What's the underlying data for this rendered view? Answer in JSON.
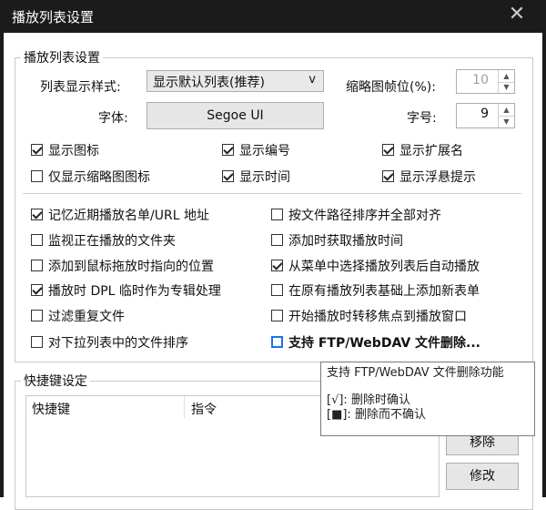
{
  "window": {
    "title": "播放列表设置",
    "close_icon": "close-icon"
  },
  "playlist_group": {
    "title": "播放列表设置",
    "display_style_label": "列表显示样式:",
    "display_style_value": "显示默认列表(推荐)",
    "dropdown_arrow": "v",
    "thumb_frame_label": "缩略图帧位(%):",
    "thumb_frame_value": "10",
    "font_label": "字体:",
    "font_value": "Segoe UI",
    "font_size_label": "字号:",
    "font_size_value": "9",
    "checks_top": [
      {
        "label": "显示图标",
        "checked": true
      },
      {
        "label": "显示编号",
        "checked": true
      },
      {
        "label": "显示扩展名",
        "checked": true
      },
      {
        "label": "仅显示缩略图图标",
        "checked": false
      },
      {
        "label": "显示时间",
        "checked": true
      },
      {
        "label": "显示浮悬提示",
        "checked": true
      }
    ],
    "checks_left": [
      {
        "label": "记忆近期播放名单/URL 地址",
        "checked": true
      },
      {
        "label": "监视正在播放的文件夹",
        "checked": false
      },
      {
        "label": "添加到鼠标拖放时指向的位置",
        "checked": false
      },
      {
        "label": "播放时 DPL 临时作为专辑处理",
        "checked": true
      },
      {
        "label": "过滤重复文件",
        "checked": false
      },
      {
        "label": "对下拉列表中的文件排序",
        "checked": false
      }
    ],
    "checks_right": [
      {
        "label": "按文件路径排序并全部对齐",
        "checked": false
      },
      {
        "label": "添加时获取播放时间",
        "checked": false
      },
      {
        "label": "从菜单中选择播放列表后自动播放",
        "checked": true
      },
      {
        "label": "在原有播放列表基础上添加新表单",
        "checked": false
      },
      {
        "label": "开始播放时转移焦点到播放窗口",
        "checked": false
      },
      {
        "label": "支持 FTP/WebDAV 文件删除...",
        "checked": false
      }
    ]
  },
  "shortcut_group": {
    "title": "快捷键设定",
    "col_key": "快捷键",
    "col_cmd": "指令",
    "remove_button": "移除",
    "edit_button": "修改"
  },
  "tooltip": {
    "line1": "支持 FTP/WebDAV 文件删除功能",
    "line2": "[√]: 删除时确认",
    "line3": "[■]: 删除而不确认"
  },
  "colors": {
    "titlebar": "#1b1b1b",
    "focus": "#1a73e8"
  }
}
